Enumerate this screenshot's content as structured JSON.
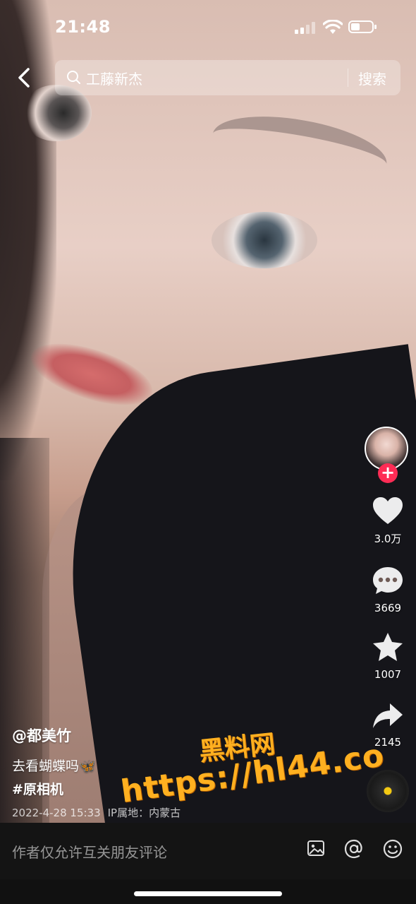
{
  "status": {
    "time": "21:48"
  },
  "search": {
    "query": "工藤新杰",
    "button_label": "搜索"
  },
  "actions": {
    "likes": "3.0万",
    "comments": "3669",
    "favorites": "1007",
    "shares": "2145"
  },
  "post": {
    "author": "@都美竹",
    "description": "去看蝴蝶吗",
    "emoji": "🦋",
    "hashtag": "#原相机",
    "date": "2022-4-28 15:33",
    "ip_location": "IP属地：内蒙古"
  },
  "watermark": {
    "line1": "黑料网",
    "line2": "https://hl44.co"
  },
  "comment_bar": {
    "placeholder": "作者仅允许互关朋友评论"
  },
  "icons": {
    "back": "chevron-left-icon",
    "search": "search-icon",
    "like": "heart-icon",
    "comment": "comment-bubble-icon",
    "favorite": "star-icon",
    "share": "share-arrow-icon",
    "image": "image-icon",
    "mention": "at-icon",
    "emoji": "smiley-icon"
  },
  "colors": {
    "follow_accent": "#fe2c55",
    "music_disc_center": "#f3c913",
    "watermark": "#ffb020"
  }
}
